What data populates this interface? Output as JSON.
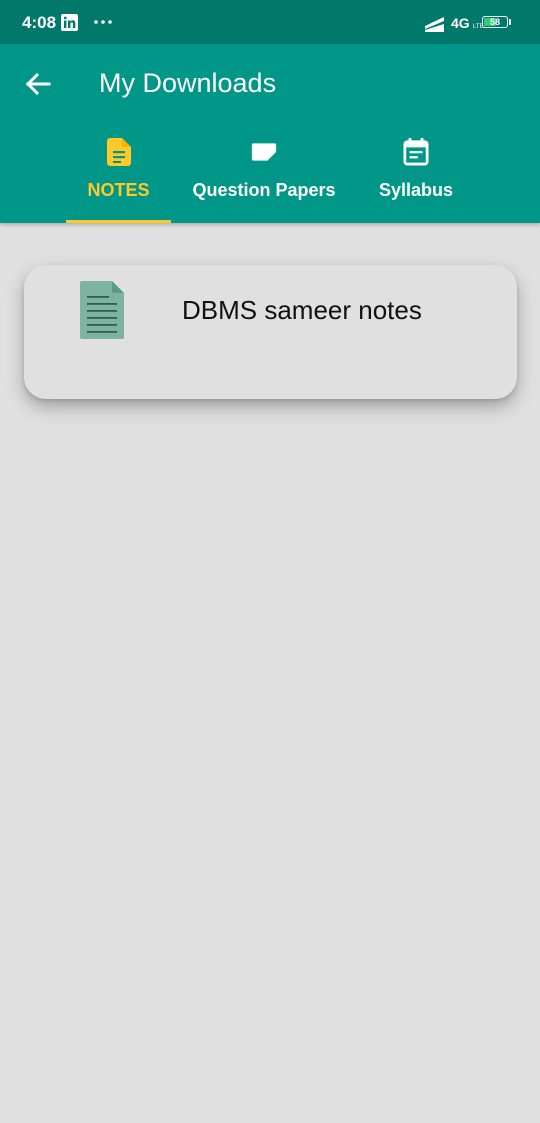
{
  "status_bar": {
    "time": "4:08",
    "network": "4G",
    "network_sub": "LTE",
    "battery_level": "58",
    "icons": [
      "linkedin-icon",
      "more-dots-icon",
      "signal-icon",
      "battery-icon"
    ]
  },
  "app_bar": {
    "title": "My Downloads",
    "back_icon": "arrow-left-icon"
  },
  "tabs": [
    {
      "label": "NOTES",
      "icon": "file-document-icon",
      "active": true
    },
    {
      "label": "Question Papers",
      "icon": "note-icon",
      "active": false
    },
    {
      "label": "Syllabus",
      "icon": "calendar-text-icon",
      "active": false
    }
  ],
  "downloads": [
    {
      "name": "DBMS sameer notes",
      "icon": "file-document-icon"
    }
  ],
  "colors": {
    "status_bar": "#00796b",
    "app_bar": "#009688",
    "accent": "#ffca28",
    "background": "#e0e0e0",
    "file_icon": "#7cb3a1"
  }
}
